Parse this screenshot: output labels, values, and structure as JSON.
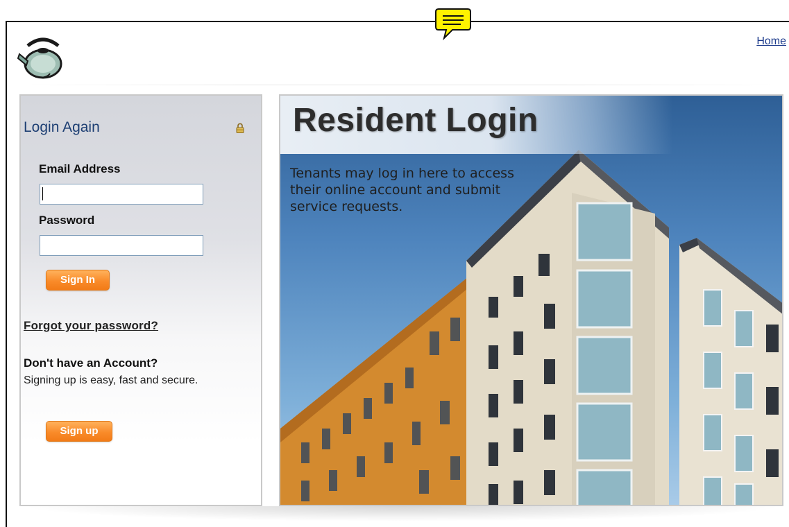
{
  "header": {
    "home_link": "Home",
    "logo_icon": "kettle-icon",
    "note_icon": "speech-bubble-icon"
  },
  "login": {
    "title": "Login Again",
    "lock_icon": "lock-icon",
    "email_label": "Email Address",
    "email_value": "",
    "password_label": "Password",
    "password_value": "",
    "sign_in_label": "Sign In",
    "forgot_link": "Forgot your password?",
    "no_account_heading": "Don't have an Account?",
    "signup_text": "Signing up is easy, fast and secure.",
    "sign_up_label": "Sign up"
  },
  "hero": {
    "title": "Resident Login",
    "text": "Tenants may log in here to access their online account and submit service requests."
  },
  "colors": {
    "accent_orange": "#f98b2a",
    "title_blue": "#1d3f73",
    "link_blue": "#1d3b8c",
    "note_yellow": "#fff200"
  }
}
